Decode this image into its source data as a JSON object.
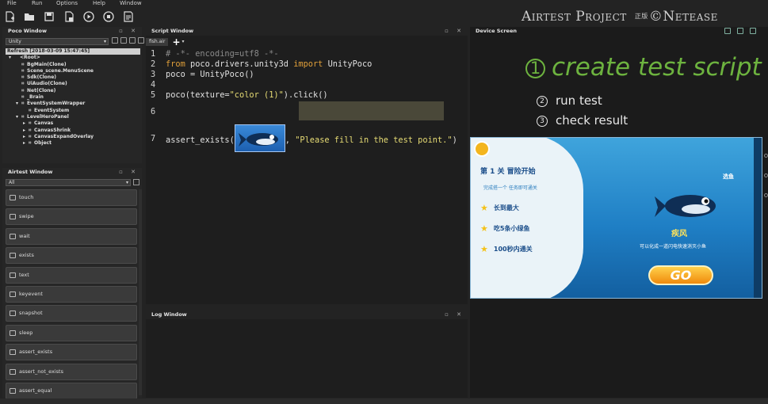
{
  "menu": [
    "File",
    "Run",
    "Options",
    "Help",
    "Window"
  ],
  "toolbar": [
    "new-file-icon",
    "open-folder-icon",
    "save-icon",
    "save-as-icon",
    "run-icon",
    "stop-icon",
    "report-icon"
  ],
  "brand": {
    "name": "Airtest Project",
    "seal": "正版",
    "company": "©Netease"
  },
  "poco": {
    "title": "Poco Window",
    "mode": "Unity",
    "refresh": "Refresh [2018-03-09 15:47:45]",
    "tree": [
      {
        "label": "<Root>",
        "depth": 0,
        "expander": "▾"
      },
      {
        "label": "BgMain(Clone)",
        "depth": 1,
        "expander": ""
      },
      {
        "label": "Scene_scene.MenuScene",
        "depth": 1,
        "expander": ""
      },
      {
        "label": "Sdk(Clone)",
        "depth": 1,
        "expander": ""
      },
      {
        "label": "UiAudio(Clone)",
        "depth": 1,
        "expander": ""
      },
      {
        "label": "Net(Clone)",
        "depth": 1,
        "expander": ""
      },
      {
        "label": "_Brain",
        "depth": 1,
        "expander": ""
      },
      {
        "label": "EventSystemWrapper",
        "depth": 1,
        "expander": "▾"
      },
      {
        "label": "EventSystem",
        "depth": 2,
        "expander": ""
      },
      {
        "label": "LevelHeroPanel",
        "depth": 1,
        "expander": "▾"
      },
      {
        "label": "Canvas",
        "depth": 2,
        "expander": "▸"
      },
      {
        "label": "CanvasShrink",
        "depth": 2,
        "expander": "▸"
      },
      {
        "label": "CanvasExpandOverlay",
        "depth": 2,
        "expander": "▸"
      },
      {
        "label": "Object",
        "depth": 2,
        "expander": "▸"
      }
    ]
  },
  "airtest": {
    "title": "Airtest Window",
    "filter": "All",
    "commands": [
      "touch",
      "swipe",
      "wait",
      "exists",
      "text",
      "keyevent",
      "snapshot",
      "sleep",
      "assert_exists",
      "assert_not_exists",
      "assert_equal"
    ]
  },
  "script": {
    "title": "Script Window",
    "tab": "fish.air",
    "add": "+",
    "lines": [
      {
        "n": "1",
        "parts": [
          {
            "t": "# -*- encoding=utf8 -*-",
            "c": "cmt"
          }
        ]
      },
      {
        "n": "2",
        "parts": [
          {
            "t": "from ",
            "c": "kw"
          },
          {
            "t": "poco.drivers.unity3d ",
            "c": ""
          },
          {
            "t": "import",
            "c": "kw"
          },
          {
            "t": " UnityPoco",
            "c": ""
          }
        ]
      },
      {
        "n": "3",
        "parts": [
          {
            "t": "poco = UnityPoco()",
            "c": ""
          }
        ]
      },
      {
        "n": "4",
        "parts": []
      },
      {
        "n": "5",
        "parts": [
          {
            "t": "poco(texture=",
            "c": ""
          },
          {
            "t": "\"color (1)\"",
            "c": "str"
          },
          {
            "t": ").click()",
            "c": ""
          }
        ]
      },
      {
        "n": "6",
        "parts": [
          {
            "t": "assert_exists(",
            "c": ""
          },
          {
            "img": true
          },
          {
            "t": ", ",
            "c": ""
          },
          {
            "t": "\"Please fill in the test point.\"",
            "c": "str"
          },
          {
            "t": ")",
            "c": ""
          }
        ]
      },
      {
        "n": "7",
        "parts": []
      }
    ]
  },
  "log": {
    "title": "Log Window"
  },
  "device": {
    "title": "Device Screen",
    "steps": [
      {
        "num": "①",
        "text": "create test script"
      },
      {
        "num": "②",
        "text": "run test"
      },
      {
        "num": "③",
        "text": "check result"
      }
    ],
    "game": {
      "title": "第 1 关 冒险开始",
      "subtitle": "完成搭一个 任务即可通关",
      "goals": [
        "长到最大",
        "吃5条小绿鱼",
        "100秒内通关"
      ],
      "pick": "选鱼",
      "fish_name": "疾风",
      "fish_desc": "可以化成一道闪电快速消灭小鱼",
      "go": "GO"
    }
  }
}
